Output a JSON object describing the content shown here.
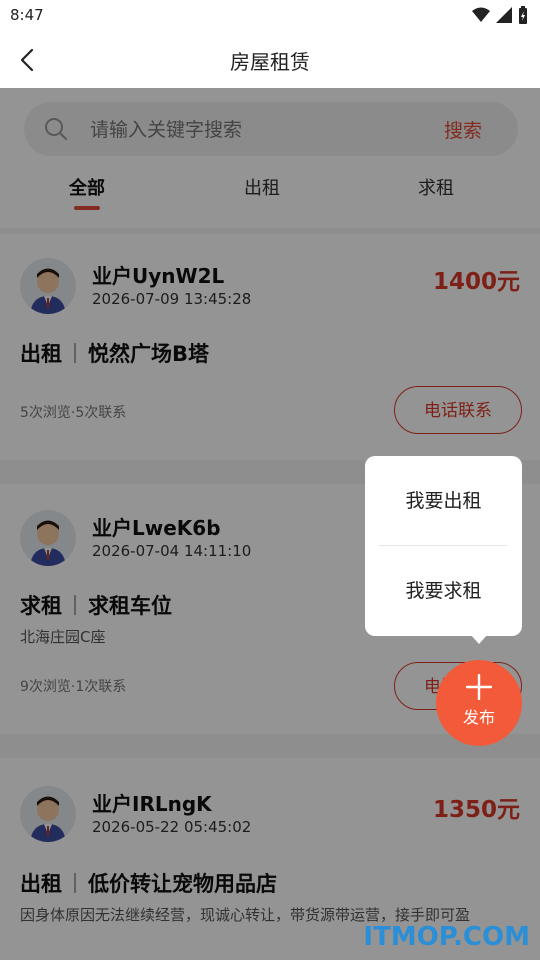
{
  "status": {
    "time": "8:47"
  },
  "nav": {
    "title": "房屋租赁"
  },
  "search": {
    "placeholder": "请输入关键字搜索",
    "button": "搜索"
  },
  "tabs": [
    {
      "label": "全部"
    },
    {
      "label": "出租"
    },
    {
      "label": "求租"
    }
  ],
  "posts": [
    {
      "user": "业户UynW2L",
      "time": "2026-07-09 13:45:28",
      "price": "1400元",
      "type": "出租",
      "title": "悦然广场B塔",
      "sub": "",
      "stats": "5次浏览·5次联系",
      "contact": "电话联系"
    },
    {
      "user": "业户LweK6b",
      "time": "2026-07-04 14:11:10",
      "price": "",
      "type": "求租",
      "title": "求租车位",
      "sub": "北海庄园C座",
      "stats": "9次浏览·1次联系",
      "contact": "电话联系"
    },
    {
      "user": "业户IRLngK",
      "time": "2026-05-22 05:45:02",
      "price": "1350元",
      "type": "出租",
      "title": "低价转让宠物用品店",
      "sub": "因身体原因无法继续经营，现诚心转让，带货源带运营，接手即可盈",
      "stats": "",
      "contact": ""
    }
  ],
  "popup": {
    "rent_out": "我要出租",
    "rent_seek": "我要求租"
  },
  "fab": {
    "label": "发布"
  },
  "watermark": "ITMOP.COM",
  "colors": {
    "accent": "#d83a2a",
    "fab": "#f35a3a"
  }
}
